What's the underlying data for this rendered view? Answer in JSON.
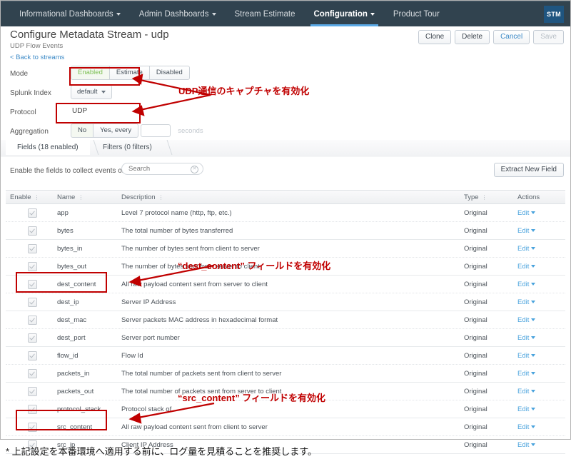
{
  "topnav": {
    "items": [
      {
        "label": "Informational Dashboards",
        "caret": true,
        "active": false
      },
      {
        "label": "Admin Dashboards",
        "caret": true,
        "active": false
      },
      {
        "label": "Stream Estimate",
        "caret": false,
        "active": false
      },
      {
        "label": "Configuration",
        "caret": true,
        "active": true
      },
      {
        "label": "Product Tour",
        "caret": false,
        "active": false
      }
    ],
    "logo": "STM"
  },
  "header": {
    "title": "Configure Metadata Stream - udp",
    "subtitle": "UDP Flow Events",
    "back_link": "< Back to streams",
    "buttons": [
      {
        "label": "Clone",
        "style": "normal"
      },
      {
        "label": "Delete",
        "style": "normal"
      },
      {
        "label": "Cancel",
        "style": "link"
      },
      {
        "label": "Save",
        "style": "disabled"
      }
    ]
  },
  "form": {
    "mode": {
      "label": "Mode",
      "options": [
        "Enabled",
        "Estimate",
        "Disabled"
      ],
      "selected": "Enabled"
    },
    "splunk_index": {
      "label": "Splunk Index",
      "value": "default"
    },
    "protocol": {
      "label": "Protocol",
      "value": "UDP"
    },
    "aggregation": {
      "label": "Aggregation",
      "options": [
        "No",
        "Yes, every"
      ],
      "selected": "No",
      "interval_value": "",
      "unit_label": "seconds"
    }
  },
  "tabs": [
    {
      "label": "Fields (18 enabled)",
      "active": true
    },
    {
      "label": "Filters (0 filters)",
      "active": false
    }
  ],
  "toolbar": {
    "hint": "Enable the fields to collect events on.",
    "search_placeholder": "Search",
    "search_value": "",
    "extract_label": "Extract New Field"
  },
  "table": {
    "columns": [
      "Enable",
      "Name",
      "Description",
      "Type",
      "Actions"
    ],
    "action_label": "Edit",
    "rows": [
      {
        "enabled": true,
        "name": "app",
        "description": "Level 7 protocol name (http, ftp, etc.)",
        "type": "Original"
      },
      {
        "enabled": true,
        "name": "bytes",
        "description": "The total number of bytes transferred",
        "type": "Original"
      },
      {
        "enabled": true,
        "name": "bytes_in",
        "description": "The number of bytes sent from client to server",
        "type": "Original"
      },
      {
        "enabled": true,
        "name": "bytes_out",
        "description": "The number of bytes sent from server to client",
        "type": "Original"
      },
      {
        "enabled": true,
        "name": "dest_content",
        "description": "All raw payload content sent from server to client",
        "type": "Original"
      },
      {
        "enabled": true,
        "name": "dest_ip",
        "description": "Server IP Address",
        "type": "Original"
      },
      {
        "enabled": true,
        "name": "dest_mac",
        "description": "Server packets MAC address in hexadecimal format",
        "type": "Original"
      },
      {
        "enabled": true,
        "name": "dest_port",
        "description": "Server port number",
        "type": "Original"
      },
      {
        "enabled": true,
        "name": "flow_id",
        "description": "Flow Id",
        "type": "Original"
      },
      {
        "enabled": true,
        "name": "packets_in",
        "description": "The total number of packets sent from client to server",
        "type": "Original"
      },
      {
        "enabled": true,
        "name": "packets_out",
        "description": "The total number of packets sent from server to client",
        "type": "Original"
      },
      {
        "enabled": true,
        "name": "protocol_stack",
        "description": "Protocol stack of",
        "type": "Original"
      },
      {
        "enabled": true,
        "name": "src_content",
        "description": "All raw payload content sent from client to server",
        "type": "Original"
      },
      {
        "enabled": true,
        "name": "src_ip",
        "description": "Client IP Address",
        "type": "Original"
      }
    ]
  },
  "annotations": {
    "callout_mode": "UDP通信のキャプチャを有効化",
    "callout_dest_content": "“dest_content” フィールドを有効化",
    "callout_src_content": "“src_content” フィールドを有効化",
    "color": "#c00000"
  },
  "footnote": "* 上記設定を本番環境へ適用する前に、ログ量を見積ることを推奨します。"
}
